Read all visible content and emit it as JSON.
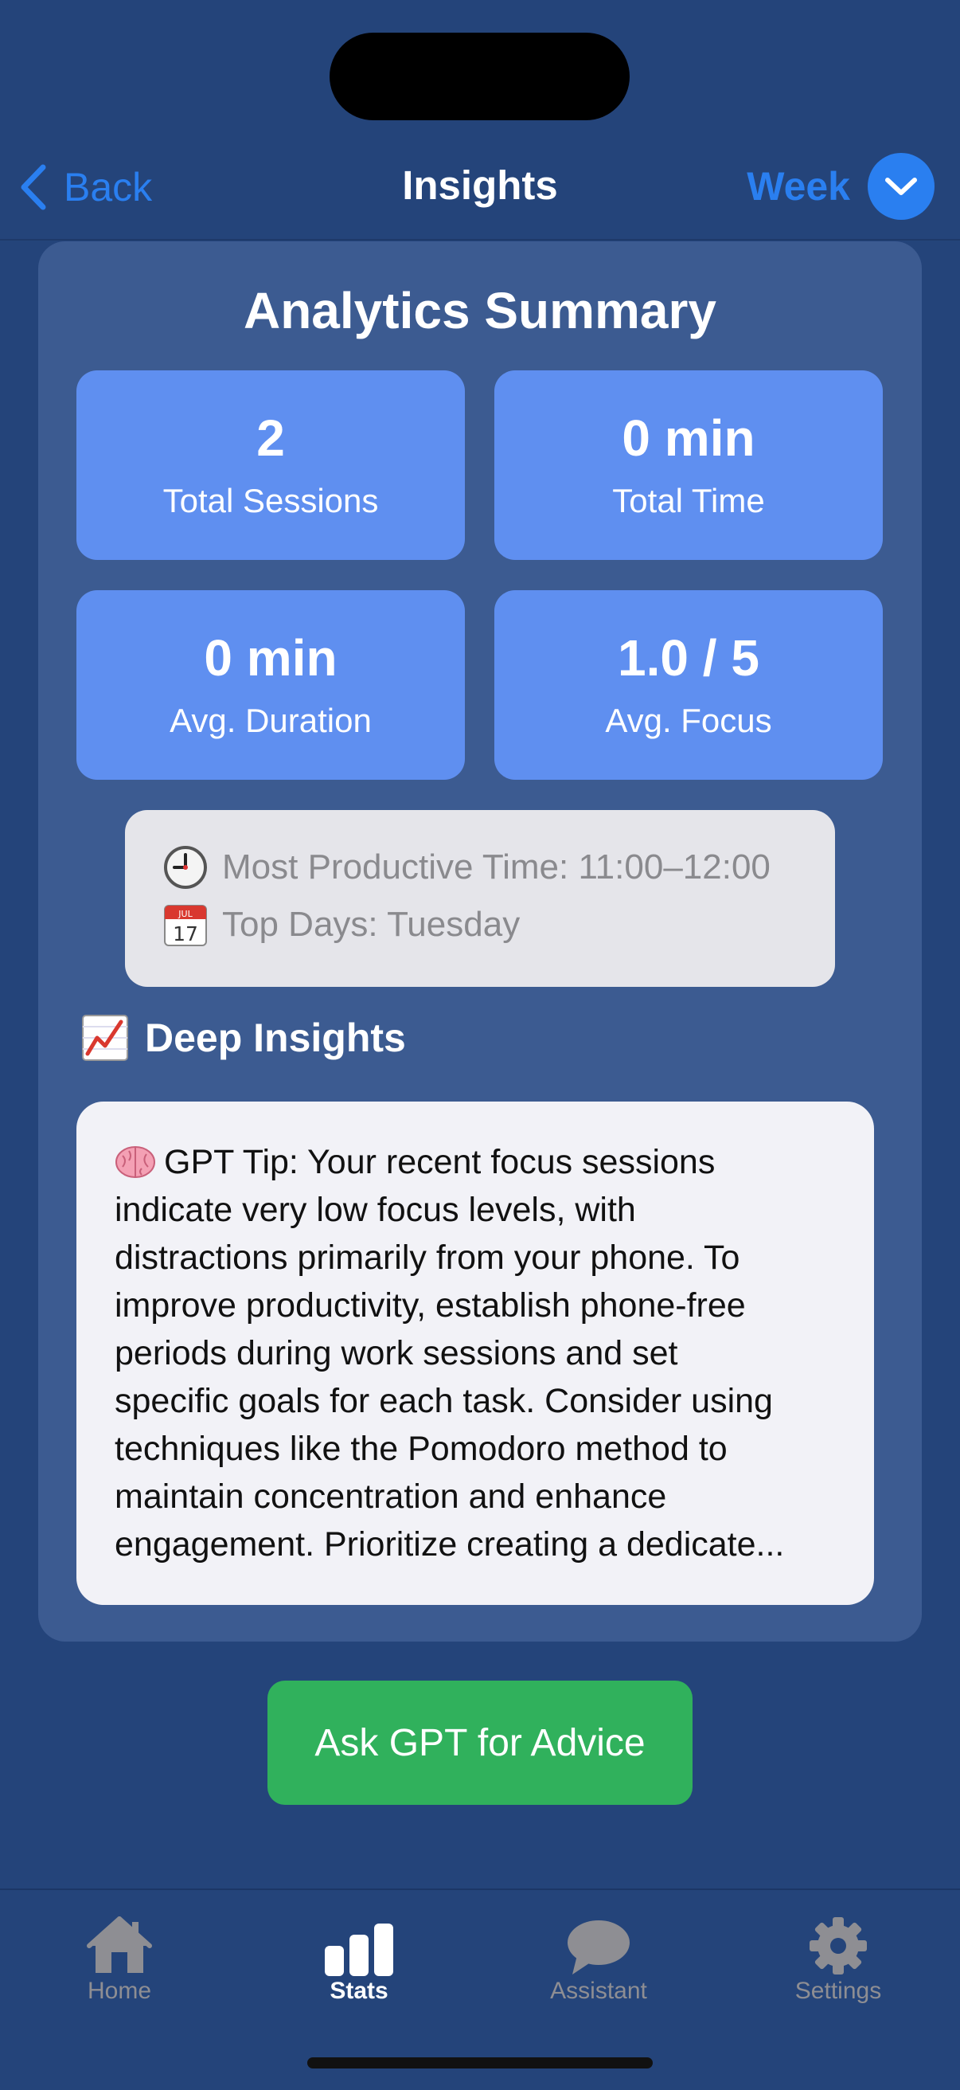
{
  "nav": {
    "back_label": "Back",
    "title": "Insights",
    "period_label": "Week"
  },
  "summary": {
    "title": "Analytics Summary",
    "stats": [
      {
        "value": "2",
        "label": "Total Sessions"
      },
      {
        "value": "0 min",
        "label": "Total Time"
      },
      {
        "value": "0 min",
        "label": "Avg. Duration"
      },
      {
        "value": "1.0 / 5",
        "label": "Avg. Focus"
      }
    ],
    "productive_time": "Most Productive Time: 11:00–12:00",
    "top_days": "Top Days: Tuesday",
    "calendar_icon_month": "JUL",
    "calendar_icon_day": "17"
  },
  "deep_insights": {
    "title": "Deep Insights",
    "tip_lines": [
      "GPT Tip: Your recent focus sessions",
      "indicate very low focus levels, with",
      "distractions primarily from your phone. To",
      "improve productivity, establish phone-free",
      "periods during work sessions and set",
      "specific goals for each task. Consider using",
      "techniques like the Pomodoro method to",
      "maintain concentration and enhance",
      "engagement. Prioritize creating a dedicate..."
    ]
  },
  "ask_button_label": "Ask GPT for Advice",
  "tabs": [
    {
      "label": "Home",
      "icon": "house-icon",
      "active": false
    },
    {
      "label": "Stats",
      "icon": "bar-chart-icon",
      "active": true
    },
    {
      "label": "Assistant",
      "icon": "chat-bubble-icon",
      "active": false
    },
    {
      "label": "Settings",
      "icon": "gear-icon",
      "active": false
    }
  ],
  "colors": {
    "background": "#24447a",
    "card": "#3c5b91",
    "stat_tile": "#5f8ff0",
    "accent": "#2a7ff0",
    "button_green": "#30b15c"
  }
}
